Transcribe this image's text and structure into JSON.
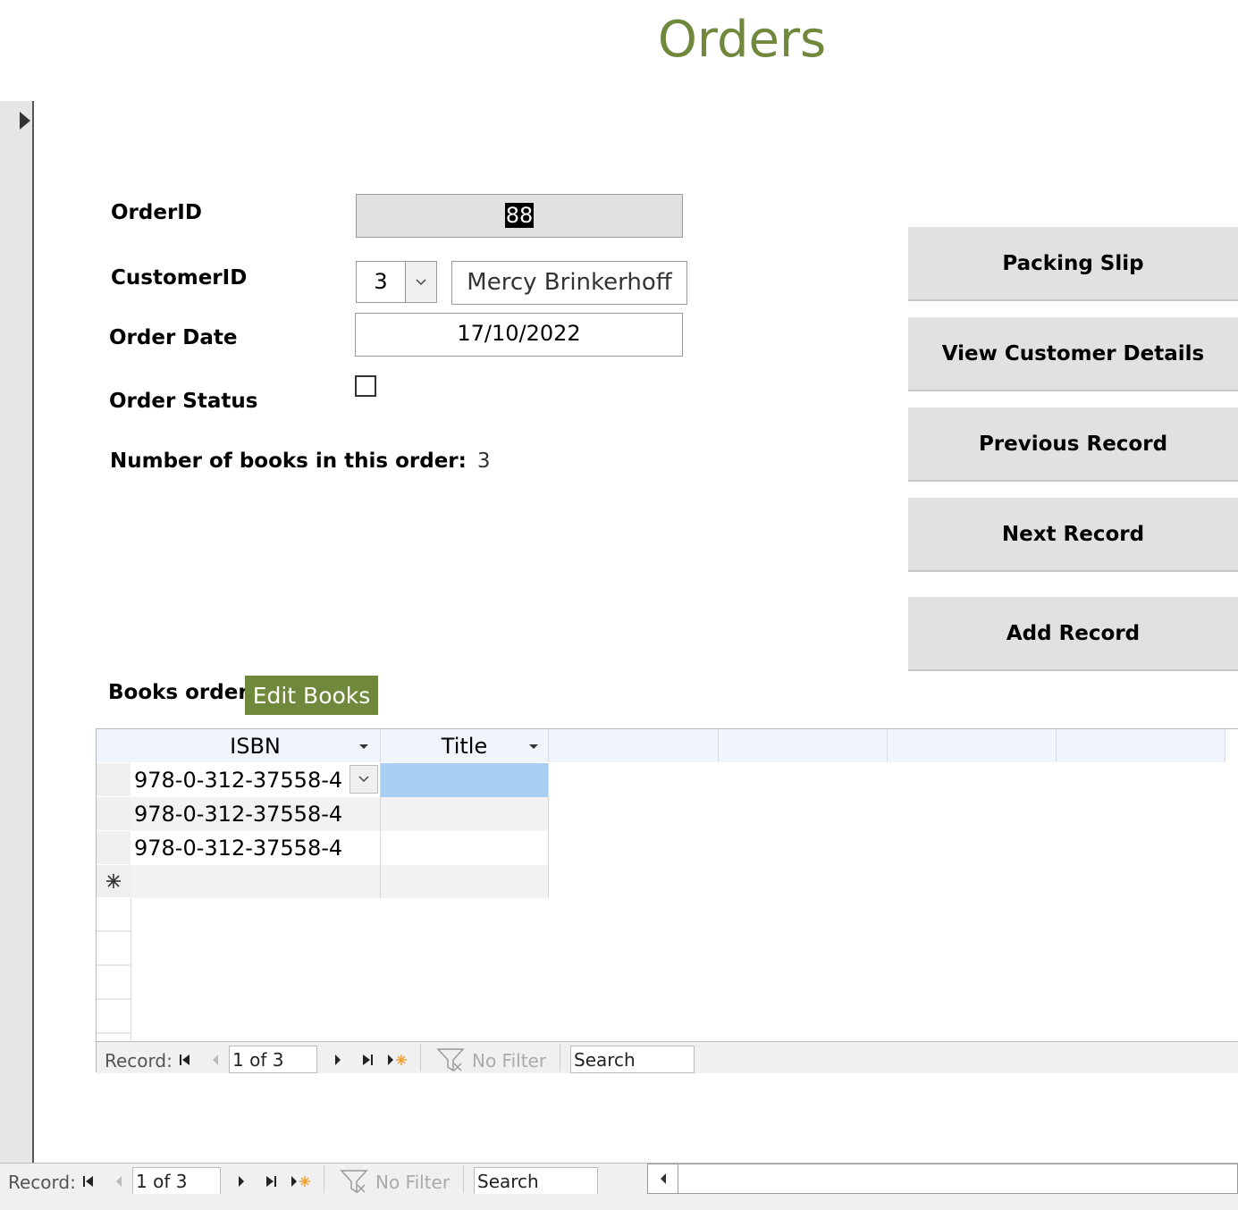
{
  "form": {
    "title": "Orders",
    "labels": {
      "order_id": "OrderID",
      "customer_id": "CustomerID",
      "order_date": "Order Date",
      "order_status": "Order Status",
      "num_books": "Number of books in this order:",
      "books_order": "Books order"
    },
    "values": {
      "order_id": "88",
      "customer_id": "3",
      "customer_name": "Mercy Brinkerhoff",
      "order_date": "17/10/2022",
      "order_status_checked": false,
      "num_books": "3"
    },
    "edit_books_label": "Edit Books"
  },
  "buttons": {
    "packing_slip": "Packing Slip",
    "view_customer": "View Customer Details",
    "previous_record": "Previous Record",
    "next_record": "Next Record",
    "add_record": "Add Record"
  },
  "subform": {
    "columns": [
      "ISBN",
      "Title"
    ],
    "rows": [
      {
        "isbn": "978-0-312-37558-4",
        "title": ""
      },
      {
        "isbn": "978-0-312-37558-4",
        "title": ""
      },
      {
        "isbn": "978-0-312-37558-4",
        "title": ""
      }
    ],
    "nav": {
      "record_label": "Record:",
      "position": "1 of 3",
      "filter": "No Filter",
      "search": "Search"
    }
  },
  "main_nav": {
    "record_label": "Record:",
    "position": "1 of 3",
    "filter": "No Filter",
    "search": "Search"
  },
  "colors": {
    "accent": "#70883c",
    "selected_cell": "#a8cff2"
  }
}
